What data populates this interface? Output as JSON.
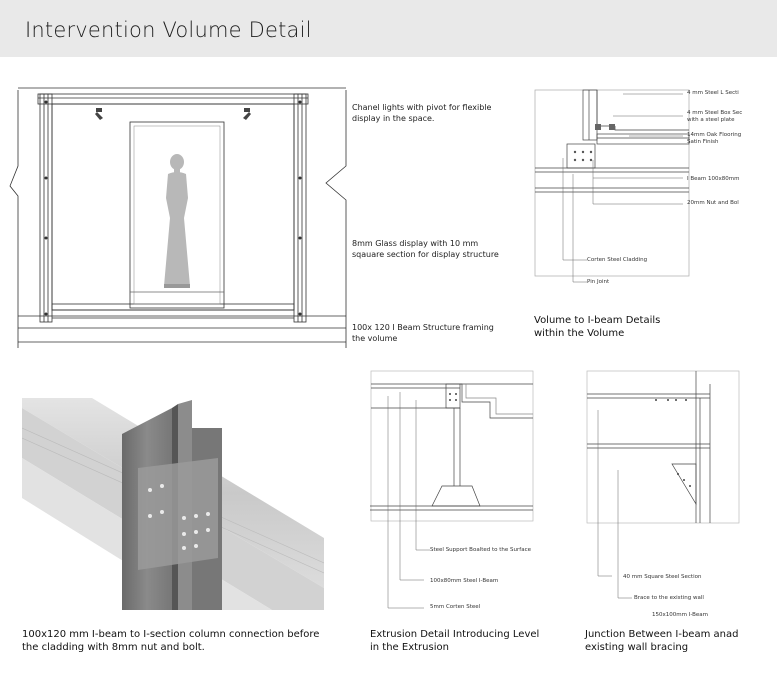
{
  "header": {
    "title": "Intervention Volume Detail"
  },
  "elevation_notes": {
    "channel_lights": "Chanel lights with pivot for flexible display in the space.",
    "glass_display": "8mm Glass display with 10 mm sqauare section for display structure",
    "beam_structure": "100x 120 I Beam Structure framing the volume"
  },
  "volume_detail": {
    "labels": {
      "steel_l": "4 mm Steel L Secti",
      "box_section": "4 mm Steel Box Sec with a steel plate",
      "oak_flooring": "14mm Oak Flooring Satin Finish",
      "ibeam": "I Beam 100x80mm",
      "nut_bolt": "20mm Nut and Bol",
      "corten": "Corten Steel Cladding",
      "pin_joint": "Pin Joint"
    },
    "caption": "Volume to I-beam Details within the Volume"
  },
  "column_render": {
    "caption": "100x120 mm I-beam to I-section column connection before the cladding with 8mm nut and bolt."
  },
  "extrusion_detail": {
    "labels": {
      "support": "Steel Support Boalted to the Surface",
      "ibeam": "100x80mm Steel I-Beam",
      "corten": "5mm Corten Steel"
    },
    "caption": "Extrusion Detail Introducing Level in the Extrusion"
  },
  "junction_detail": {
    "labels": {
      "square_section": "40 mm Square Steel Section",
      "brace": "Brace to the existing wall",
      "ibeam": "150x100mm I-Beam"
    },
    "caption": "Junction Between I-beam anad existing wall bracing"
  }
}
